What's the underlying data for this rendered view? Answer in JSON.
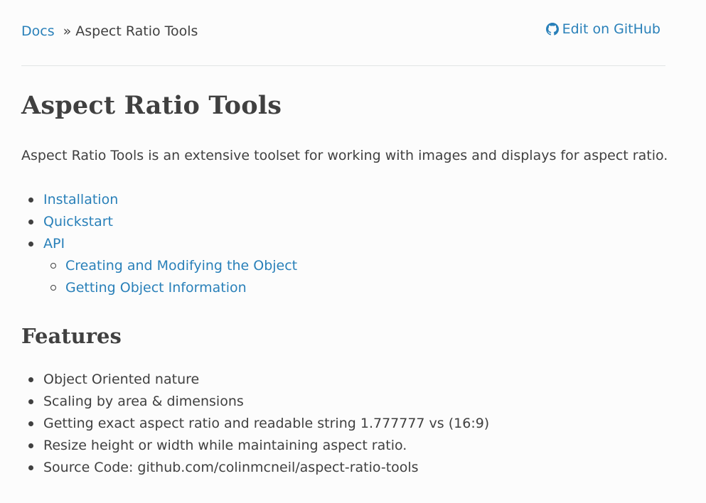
{
  "breadcrumbs": {
    "root_label": "Docs",
    "separator": "»",
    "current_label": "Aspect Ratio Tools"
  },
  "edit_link": {
    "icon": "github-icon",
    "label": "Edit on GitHub"
  },
  "page": {
    "title": "Aspect Ratio Tools",
    "intro": "Aspect Ratio Tools is an extensive toolset for working with images and displays for aspect ratio."
  },
  "toc": [
    {
      "label": "Installation",
      "level": 1
    },
    {
      "label": "Quickstart",
      "level": 1
    },
    {
      "label": "API",
      "level": 1
    },
    {
      "label": "Creating and Modifying the Object",
      "level": 2
    },
    {
      "label": "Getting Object Information",
      "level": 2
    }
  ],
  "features": {
    "heading": "Features",
    "items": [
      "Object Oriented nature",
      "Scaling by area & dimensions",
      "Getting exact aspect ratio and readable string 1.777777 vs (16:9)",
      "Resize height or width while maintaining aspect ratio.",
      "Source Code: github.com/colinmcneil/aspect-ratio-tools"
    ]
  },
  "colors": {
    "link": "#2980b9",
    "text": "#404040",
    "background": "#fcfcfc",
    "divider": "#e1e4e5"
  }
}
